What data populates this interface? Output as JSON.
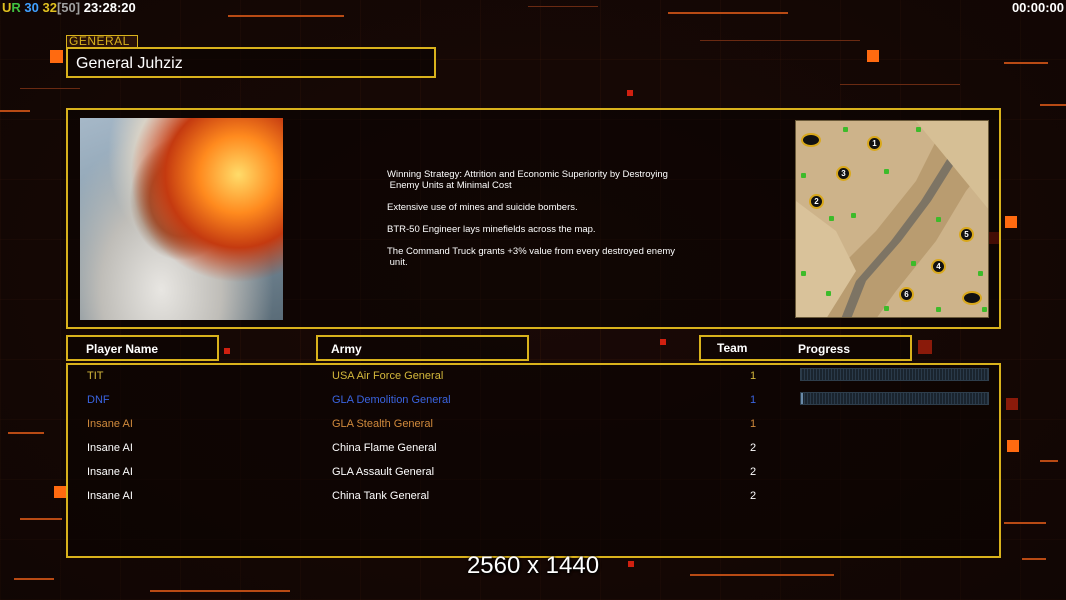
{
  "hud": {
    "ur": "UR",
    "fps": "30",
    "fps2": "32",
    "fps_cap": "[50]",
    "clock": "23:28:20",
    "timer": "00:00:00"
  },
  "general": {
    "tag": "GENERAL",
    "name": "General Juhziz",
    "strategy": [
      "Winning Strategy: Attrition and Economic Superiority by Destroying\n Enemy Units at Minimal Cost",
      "Extensive use of mines and suicide bombers.",
      "BTR-50 Engineer lays minefields across the map.",
      "The Command Truck grants +3% value from every destroyed enemy\n unit."
    ]
  },
  "minimap": {
    "start_positions": [
      "1",
      "2",
      "3",
      "4",
      "5",
      "6"
    ]
  },
  "table": {
    "headers": {
      "player": "Player Name",
      "army": "Army",
      "team": "Team",
      "progress": "Progress"
    },
    "rows": [
      {
        "name": "TIT",
        "army": "USA Air Force General",
        "team": "1",
        "color": "#d4b83c",
        "progress": 0.0
      },
      {
        "name": "DNF",
        "army": "GLA Demolition General",
        "team": "1",
        "color": "#3a64e0",
        "progress": 0.01
      },
      {
        "name": "Insane AI",
        "army": "GLA Stealth General",
        "team": "1",
        "color": "#d08a3c",
        "progress": null
      },
      {
        "name": "Insane AI",
        "army": "China Flame General",
        "team": "2",
        "color": "#ffffff",
        "progress": null
      },
      {
        "name": "Insane AI",
        "army": "GLA Assault General",
        "team": "2",
        "color": "#ffffff",
        "progress": null
      },
      {
        "name": "Insane AI",
        "army": "China Tank General",
        "team": "2",
        "color": "#ffffff",
        "progress": null
      }
    ]
  },
  "watermark": "2560 x 1440",
  "colors": {
    "accent": "#d9b21c",
    "hud_ur_u": "#e0c020",
    "hud_ur_r": "#40c040",
    "hud_fps": "#40a0ff",
    "hud_fps2": "#e0c020",
    "hud_cap": "#a0a0a0"
  }
}
